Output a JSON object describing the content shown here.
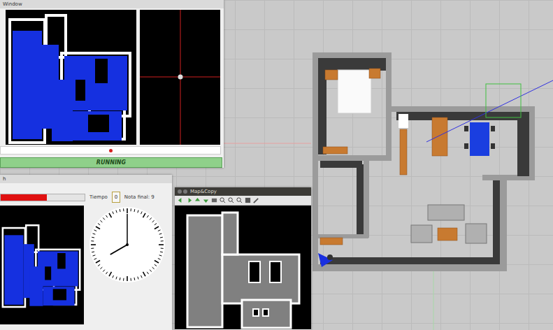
{
  "windows": {
    "sim": {
      "title": "Window",
      "status": "RUNNING",
      "indicator_on": true
    },
    "eval": {
      "title": "h",
      "progress": {
        "level": 0.55
      },
      "time_label": "Tiempo",
      "time_value": "0",
      "grade": "Nota final: 9",
      "clock": {
        "hours": 8,
        "minutes": 0
      }
    },
    "map_copy": {
      "title": "Map&Copy"
    }
  }
}
